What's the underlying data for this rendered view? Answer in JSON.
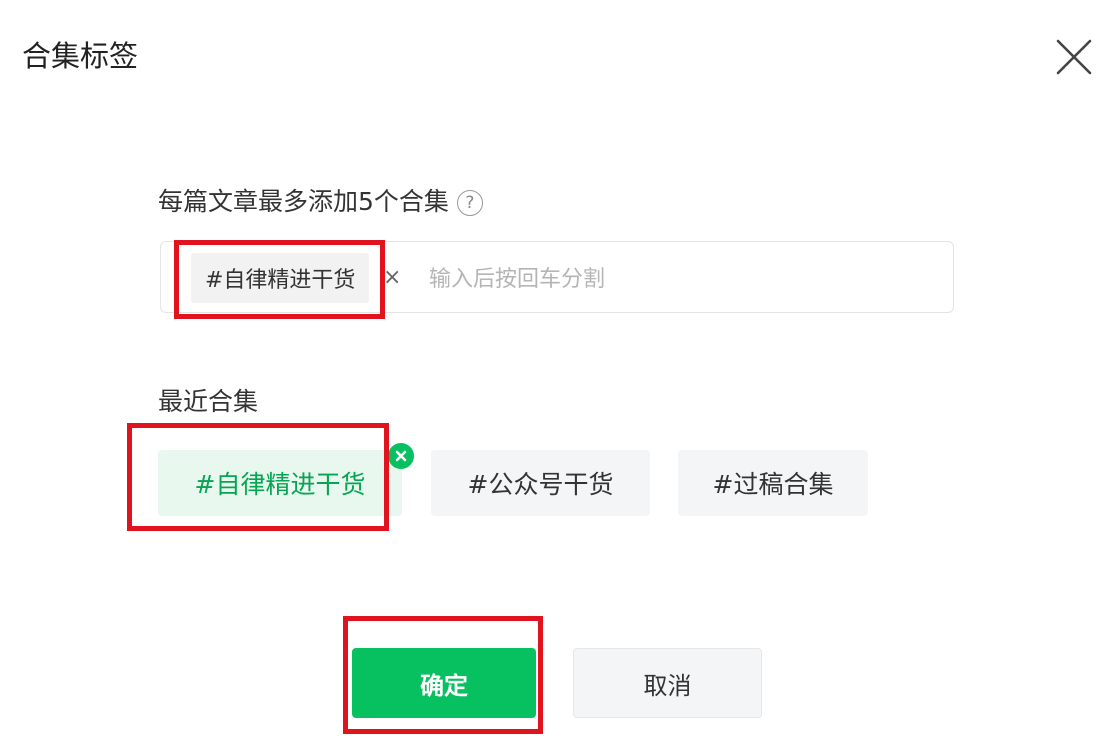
{
  "dialog": {
    "title": "合集标签",
    "close_icon": "close-icon"
  },
  "input_section": {
    "label": "每篇文章最多添加5个合集",
    "help_icon": "question-circle-icon",
    "help_glyph": "?",
    "tag": "#自律精进干货",
    "remove_glyph": "×",
    "placeholder": "输入后按回车分割"
  },
  "recent_section": {
    "label": "最近合集",
    "items": [
      {
        "label": "#自律精进干货",
        "selected": true
      },
      {
        "label": "#公众号干货",
        "selected": false
      },
      {
        "label": "#过稿合集",
        "selected": false
      }
    ],
    "selected_icon": "check-close-badge-icon"
  },
  "buttons": {
    "confirm": "确定",
    "cancel": "取消"
  },
  "colors": {
    "accent": "#07c160",
    "selected_text": "#07a553",
    "selected_bg": "#e8f8ee",
    "annotation": "#e0141e"
  }
}
